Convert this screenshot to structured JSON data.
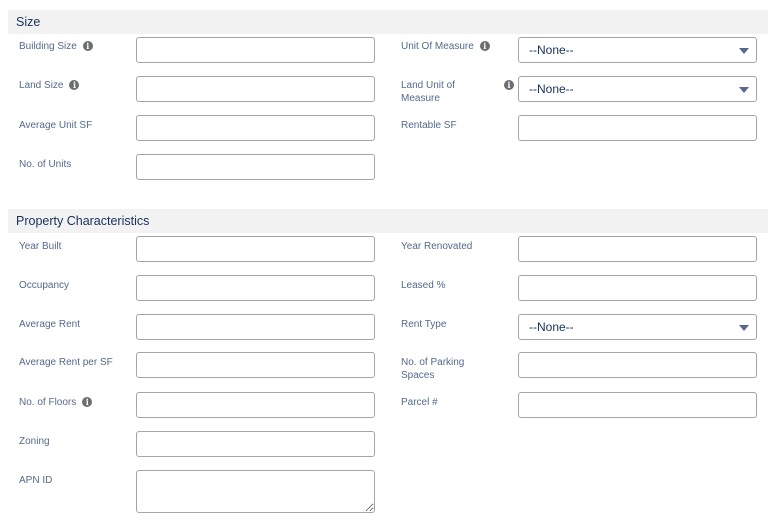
{
  "sections": {
    "size": {
      "title": "Size",
      "building_size_label": "Building Size",
      "unit_of_measure_label": "Unit Of Measure",
      "unit_of_measure_value": "--None--",
      "land_size_label": "Land Size",
      "land_unit_label": "Land Unit of Measure",
      "land_unit_value": "--None--",
      "avg_unit_sf_label": "Average Unit SF",
      "rentable_sf_label": "Rentable SF",
      "units_label": "No. of Units"
    },
    "property": {
      "title": "Property Characteristics",
      "year_built_label": "Year Built",
      "year_renovated_label": "Year Renovated",
      "occupancy_label": "Occupancy",
      "leased_label": "Leased %",
      "avg_rent_label": "Average Rent",
      "rent_type_label": "Rent Type",
      "rent_type_value": "--None--",
      "avg_rent_sf_label": "Average Rent per SF",
      "parking_label": "No. of Parking Spaces",
      "floors_label": "No. of Floors",
      "parcel_label": "Parcel #",
      "zoning_label": "Zoning",
      "apn_label": "APN ID"
    }
  },
  "icons": {
    "info": "info-icon",
    "dropdown": "chevron-down-icon"
  },
  "colors": {
    "header_bg": "#f3f2f2",
    "border": "#a5a5a5",
    "label": "#54698d"
  }
}
